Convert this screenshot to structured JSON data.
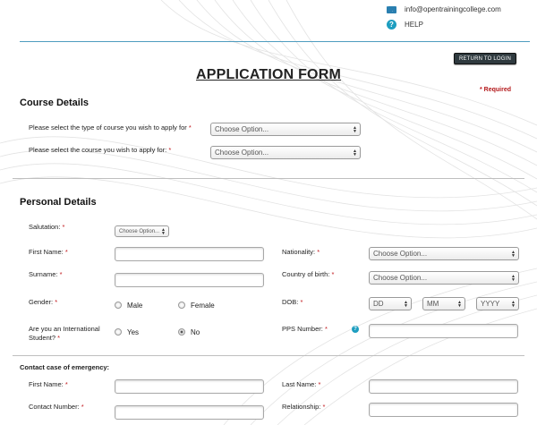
{
  "header": {
    "email": "info@opentrainingcollege.com",
    "help": "HELP",
    "return_button": "RETURN TO LOGIN",
    "title": "APPLICATION FORM",
    "required_note": "Required"
  },
  "course_details": {
    "title": "Course Details",
    "type_label": "Please select the type of course you wish to apply for",
    "type_value": "Choose Option...",
    "course_label": "Please select the course you wish to apply for:",
    "course_value": "Choose Option..."
  },
  "personal_details": {
    "title": "Personal Details",
    "salutation_label": "Salutation:",
    "salutation_value": "Choose Option...",
    "first_name_label": "First Name:",
    "surname_label": "Surname:",
    "gender_label": "Gender:",
    "gender_options": [
      "Male",
      "Female"
    ],
    "international_label_1": "Are you an International",
    "international_label_2": "Student?",
    "international_options": [
      "Yes",
      "No"
    ],
    "nationality_label": "Nationality:",
    "nationality_value": "Choose Option...",
    "country_label": "Country of birth:",
    "country_value": "Choose Option...",
    "dob_label": "DOB:",
    "dob_dd": "DD",
    "dob_mm": "MM",
    "dob_yyyy": "YYYY",
    "pps_label": "PPS Number:"
  },
  "emergency": {
    "title": "Contact case of emergency:",
    "first_name_label": "First Name:",
    "last_name_label": "Last Name:",
    "contact_number_label": "Contact Number:",
    "relationship_label": "Relationship:"
  },
  "icons": {
    "email": "envelope-icon",
    "help": "question-icon",
    "pps_info": "info-icon"
  }
}
